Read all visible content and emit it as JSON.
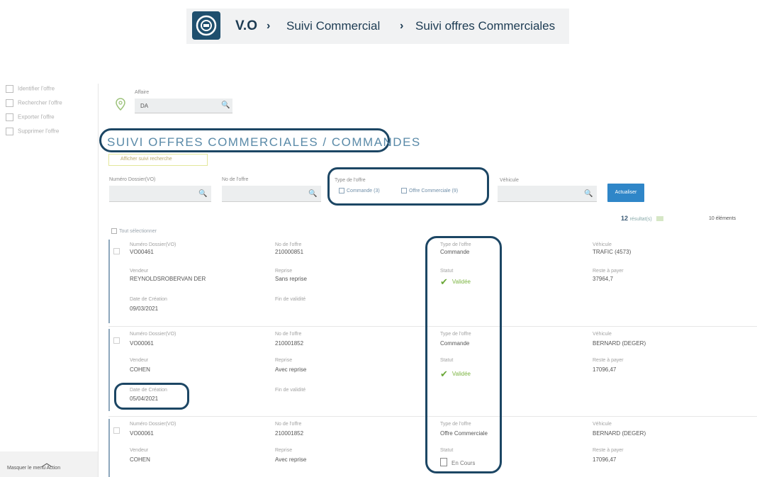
{
  "breadcrumb": {
    "root": "V.O",
    "separator": "›",
    "level1": "Suivi Commercial",
    "level2": "Suivi offres Commerciales"
  },
  "colors": {
    "navy": "#1c4664",
    "accent_blue": "#2f86c8",
    "title_blue": "#5a8aa8",
    "status_green": "#6aa737"
  },
  "sidebar": {
    "items": [
      {
        "label": "Identifier l'offre",
        "icon": "document-icon"
      },
      {
        "label": "Rechercher l'offre",
        "icon": "search-document-icon"
      },
      {
        "label": "Exporter l'offre",
        "icon": "export-icon"
      },
      {
        "label": "Supprimer l'offre",
        "icon": "delete-icon"
      }
    ],
    "hide_label": "Masquer le menu Action"
  },
  "affaire": {
    "label": "Affaire",
    "value": "DA"
  },
  "page_title": "SUIVI OFFRES COMMERCIALES / COMMANDES",
  "afficher_label": "Afficher suivi recherche",
  "filters": {
    "numero_label": "Numéro Dossier(VO)",
    "no_offre_label": "No de l'offre",
    "type_label": "Type de l'offre",
    "type_options": [
      "Commande (3)",
      "Offre Commerciale (9)"
    ],
    "vehicule_label": "Véhicule",
    "actualiser": "Actualiser"
  },
  "results": {
    "count": "12",
    "count_label": "résultat(s)",
    "per_page": "10 éléments"
  },
  "select_all_label": "Tout sélectionner",
  "field_labels": {
    "numero": "Numéro Dossier(VO)",
    "no_offre": "No de l'offre",
    "type": "Type de l'offre",
    "vehicule": "Véhicule",
    "vendeur": "Vendeur",
    "reprise": "Reprise",
    "statut": "Statut",
    "reste": "Reste à payer",
    "date_creation": "Date de Création",
    "fin_validite": "Fin de validité"
  },
  "cards": [
    {
      "numero": "VO00461",
      "no_offre": "210000851",
      "type": "Commande",
      "vehicule": "TRAFIC (4573)",
      "vendeur": "REYNOLDSROBERVAN DER",
      "reprise": "Sans reprise",
      "statut": "Validée",
      "reste": "37964,7",
      "date_creation": "09/03/2021"
    },
    {
      "numero": "VO00061",
      "no_offre": "210001852",
      "type": "Commande",
      "vehicule": "BERNARD (DEGER)",
      "vendeur": "COHEN",
      "reprise": "Avec reprise",
      "statut": "Validée",
      "reste": "17096,47",
      "date_creation": "05/04/2021"
    },
    {
      "numero": "VO00061",
      "no_offre": "210001852",
      "type": "Offre Commerciale",
      "vehicule": "BERNARD (DEGER)",
      "vendeur": "COHEN",
      "reprise": "Avec reprise",
      "statut": "En Cours",
      "reste": "17096,47"
    }
  ]
}
